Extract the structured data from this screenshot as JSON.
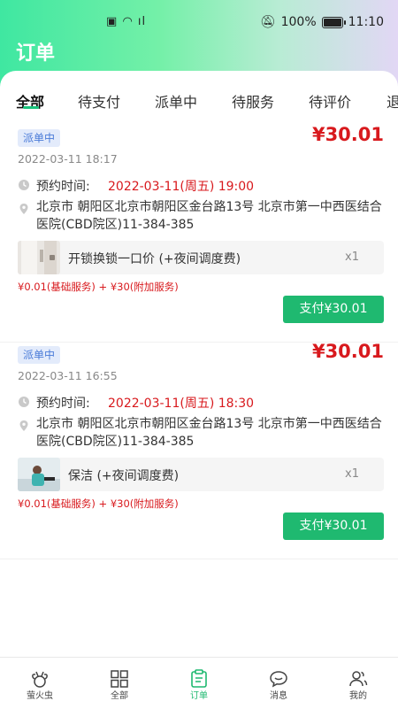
{
  "status_bar": {
    "battery": "100%",
    "time": "11:10",
    "battery_level": 1.0
  },
  "header": {
    "title": "订单"
  },
  "tabs": [
    {
      "label": "全部",
      "active": true
    },
    {
      "label": "待支付"
    },
    {
      "label": "派单中"
    },
    {
      "label": "待服务"
    },
    {
      "label": "待评价"
    },
    {
      "label": "退"
    }
  ],
  "orders": [
    {
      "status": "派单中",
      "price": "¥30.01",
      "created_at": "2022-03-11 18:17",
      "appointment_label": "预约时间:",
      "appointment_value": "2022-03-11(周五) 19:00",
      "address": "北京市 朝阳区北京市朝阳区金台路13号 北京市第一中西医结合医院(CBD院区)11-384-385",
      "service_name": "开锁换锁一口价 (+夜间调度费)",
      "quantity": "x1",
      "breakdown": "¥0.01(基础服务) + ¥30(附加服务)",
      "pay_button": "支付¥30.01"
    },
    {
      "status": "派单中",
      "price": "¥30.01",
      "created_at": "2022-03-11 16:55",
      "appointment_label": "预约时间:",
      "appointment_value": "2022-03-11(周五) 18:30",
      "address": "北京市 朝阳区北京市朝阳区金台路13号 北京市第一中西医结合医院(CBD院区)11-384-385",
      "service_name": "保洁 (+夜间调度费)",
      "quantity": "x1",
      "breakdown": "¥0.01(基础服务) + ¥30(附加服务)",
      "pay_button": "支付¥30.01"
    }
  ],
  "bottom_nav": [
    {
      "label": "萤火虫",
      "icon": "firefly-icon"
    },
    {
      "label": "全部",
      "icon": "grid-icon"
    },
    {
      "label": "订单",
      "icon": "orders-icon",
      "active": true
    },
    {
      "label": "消息",
      "icon": "message-icon"
    },
    {
      "label": "我的",
      "icon": "profile-icon"
    }
  ],
  "colors": {
    "accent": "#1fb970",
    "price": "#d8191d",
    "badge_bg": "#e3ebfb",
    "badge_text": "#4a7bd8"
  }
}
